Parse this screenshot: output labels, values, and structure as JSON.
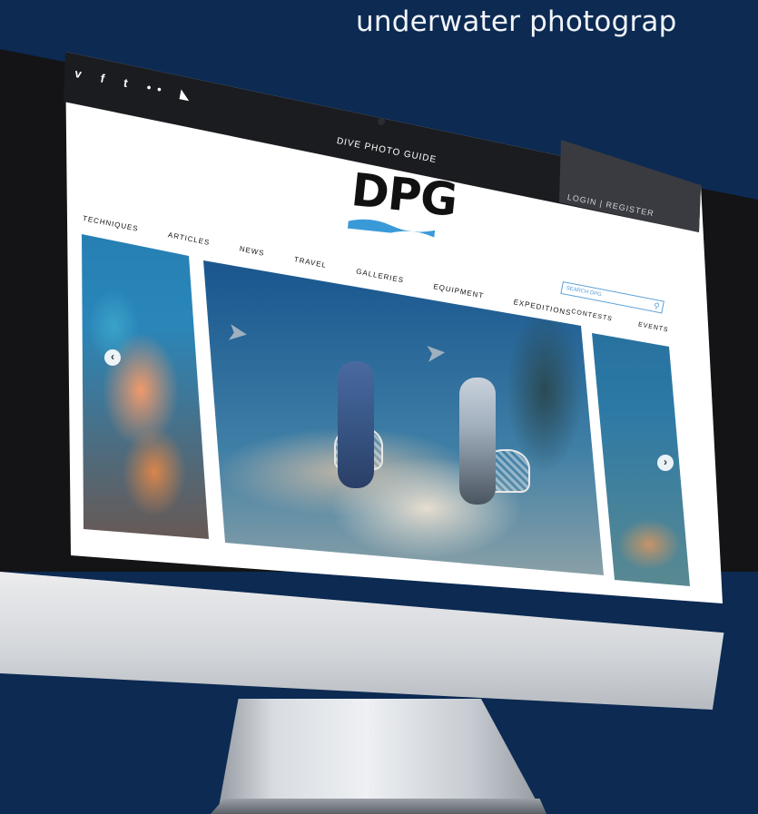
{
  "headline": "underwater photograp",
  "site": {
    "tagline": "DIVE PHOTO GUIDE",
    "logo": "DPG",
    "login": "LOGIN | REGISTER",
    "social_icons": [
      "vimeo-icon",
      "facebook-icon",
      "twitter-icon",
      "flickr-icon",
      "rss-icon"
    ],
    "social_glyphs": [
      "v",
      "f",
      "t",
      "••",
      "◣"
    ],
    "nav": [
      "TECHNIQUES",
      "ARTICLES",
      "NEWS",
      "TRAVEL",
      "GALLERIES",
      "EQUIPMENT",
      "EXPEDITIONS"
    ],
    "subnav": [
      "CONTESTS",
      "EVENTS"
    ],
    "search_placeholder": "SEARCH DPG",
    "slider": {
      "prev_glyph": "‹",
      "next_glyph": "›"
    }
  },
  "colors": {
    "background": "#0c2a52",
    "accent": "#3a9ad8"
  }
}
